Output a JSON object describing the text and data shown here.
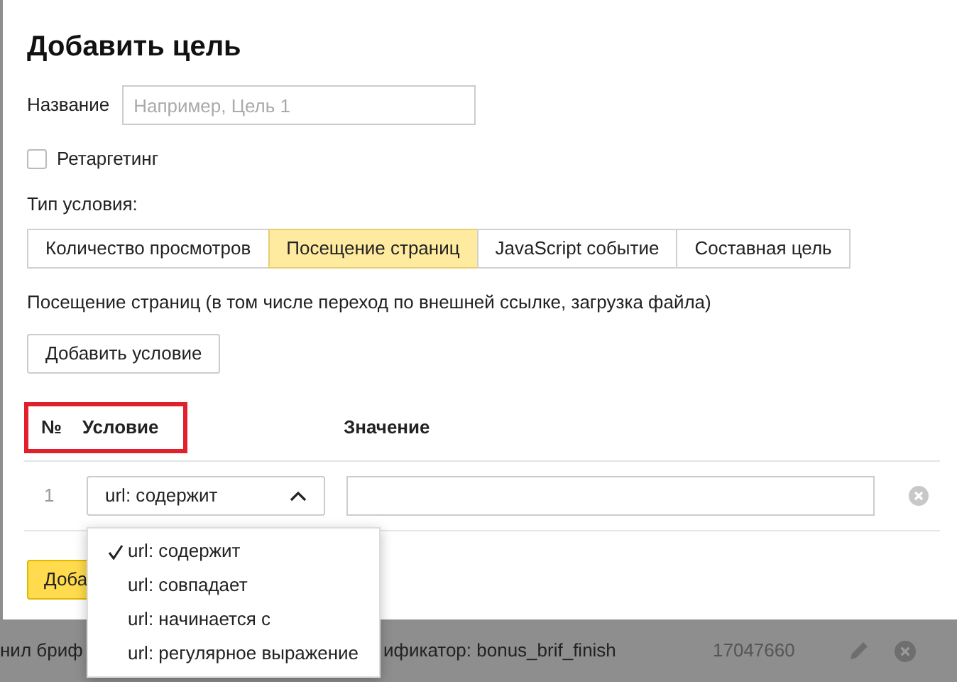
{
  "dialog": {
    "title": "Добавить цель",
    "name_field": {
      "label": "Название",
      "placeholder": "Например, Цель 1"
    },
    "retargeting": {
      "label": "Ретаргетинг",
      "checked": false
    },
    "condition_type_label": "Тип условия:",
    "tabs": [
      {
        "label": "Количество просмотров",
        "selected": false
      },
      {
        "label": "Посещение страниц",
        "selected": true
      },
      {
        "label": "JavaScript событие",
        "selected": false
      },
      {
        "label": "Составная цель",
        "selected": false
      }
    ],
    "description": "Посещение страниц (в том числе переход по внешней ссылке, загрузка файла)",
    "add_condition_button": "Добавить условие",
    "table": {
      "columns": [
        "№",
        "Условие",
        "Значение"
      ],
      "rows": [
        {
          "number": "1",
          "condition": "url: содержит",
          "expanded": true
        }
      ]
    },
    "submit_button": "Доба"
  },
  "dropdown": {
    "options": [
      {
        "label": "url: содержит",
        "selected": true
      },
      {
        "label": "url: совпадает",
        "selected": false
      },
      {
        "label": "url: начинается с",
        "selected": false
      },
      {
        "label": "url: регулярное выражение",
        "selected": false
      }
    ]
  },
  "background_row": {
    "cells": [
      "нил бриф",
      "ификатор: bonus_brif_finish",
      "17047660"
    ]
  }
}
